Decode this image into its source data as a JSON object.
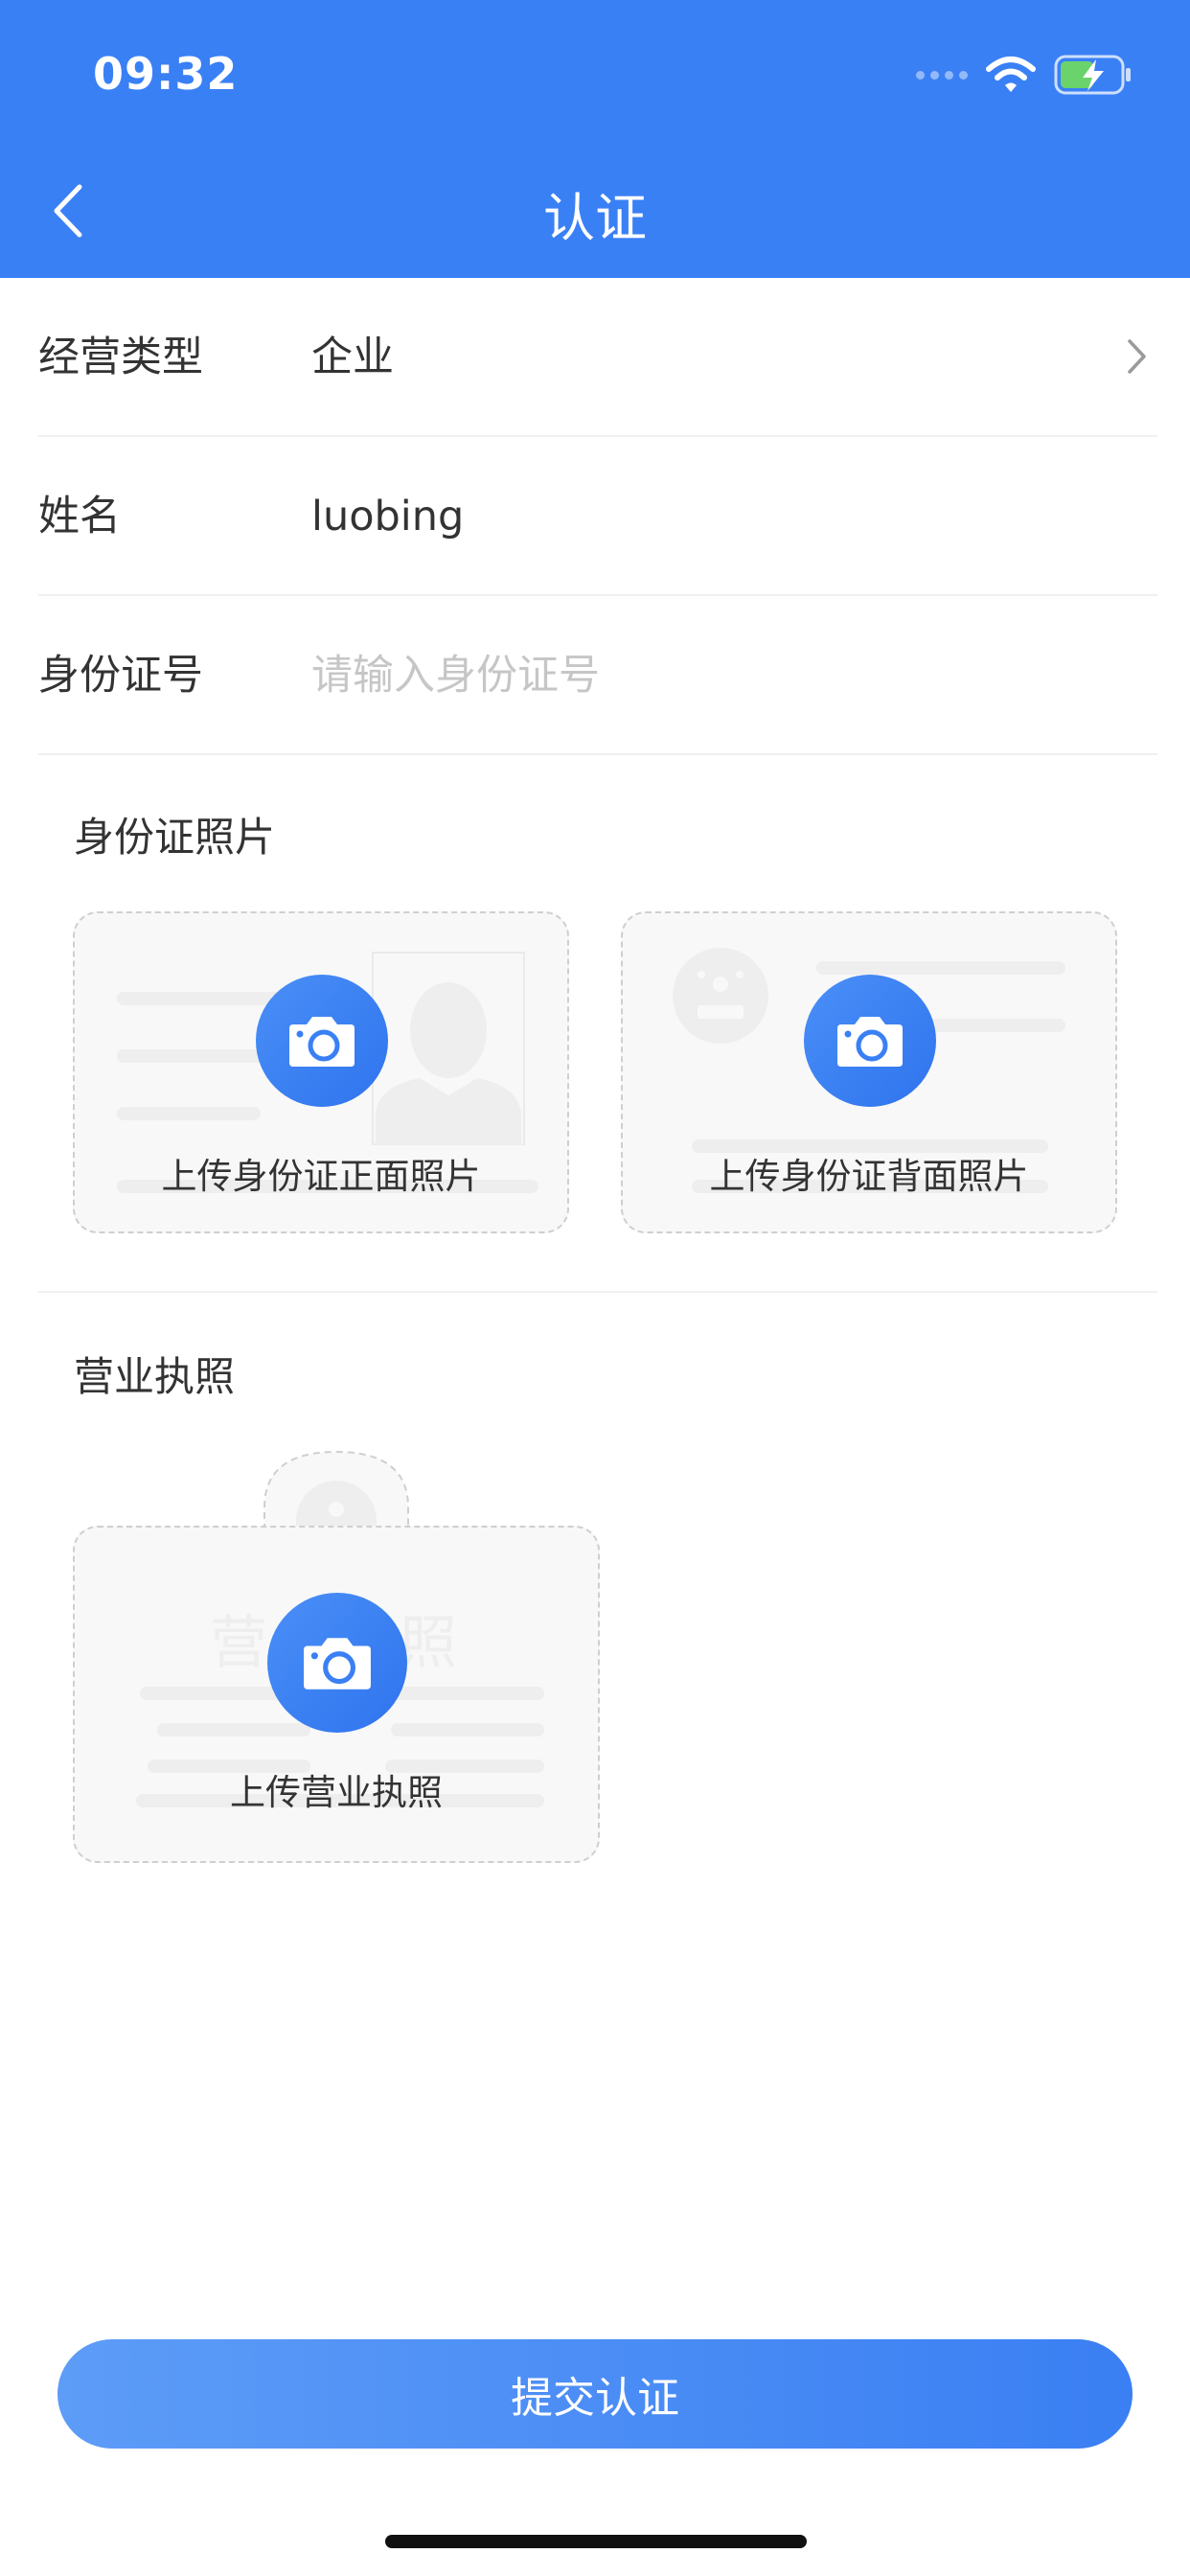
{
  "status_bar": {
    "time": "09:32"
  },
  "header": {
    "title": "认证"
  },
  "form": {
    "rows": [
      {
        "label": "经营类型",
        "value": "企业"
      },
      {
        "label": "姓名",
        "value": "luobing"
      },
      {
        "label": "身份证号",
        "placeholder": "请输入身份证号",
        "value": ""
      }
    ]
  },
  "id_section": {
    "title": "身份证照片",
    "front_label": "上传身份证正面照片",
    "back_label": "上传身份证背面照片"
  },
  "license_section": {
    "title": "营业执照",
    "watermark": "营业执照",
    "upload_label": "上传营业执照"
  },
  "submit": {
    "label": "提交认证"
  },
  "colors": {
    "primary": "#3a80f5",
    "text": "#333333",
    "placeholder": "#c6c6c6"
  },
  "icons": [
    "back-arrow-icon",
    "chevron-right-icon",
    "camera-icon",
    "wifi-icon",
    "battery-charging-icon"
  ]
}
